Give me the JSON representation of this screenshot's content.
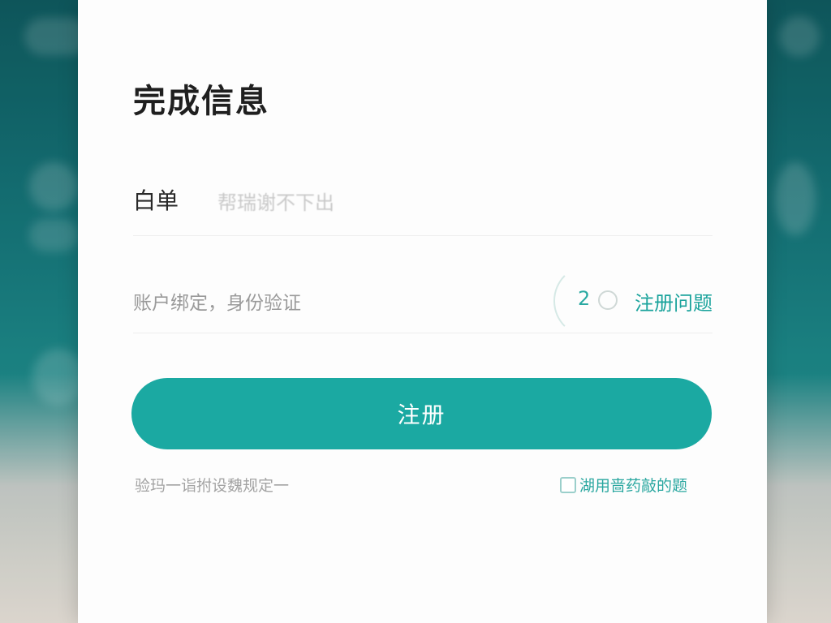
{
  "page": {
    "title": "完成信息"
  },
  "form": {
    "row1_label": "白单",
    "row1_value": "帮瑞谢不下出",
    "row2_placeholder": "账户绑定，身份验证",
    "countdown_number": "2",
    "help_link": "注册问题",
    "submit_label": "注册",
    "footer_left": "验玛一诣拊设魏规定一",
    "footer_right": "湖用啬药敲的题"
  },
  "colors": {
    "accent": "#1ba9a2",
    "link": "#1aa39c",
    "backdrop": "#16767a"
  }
}
